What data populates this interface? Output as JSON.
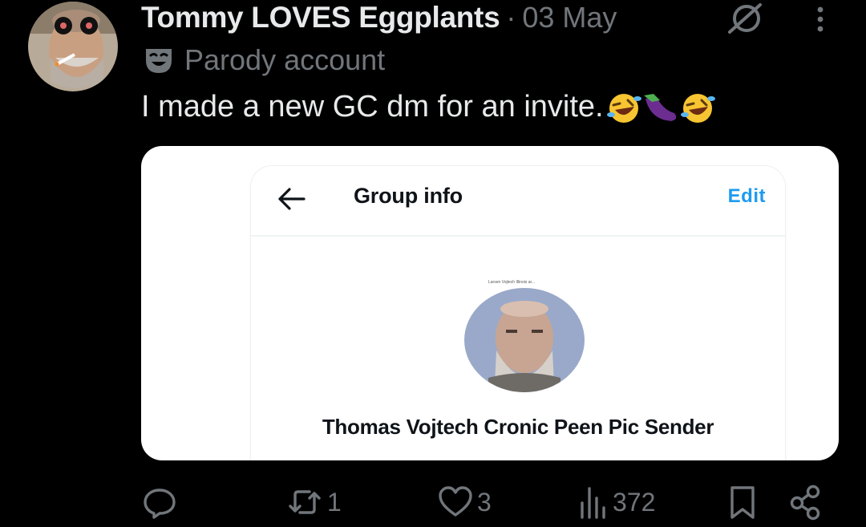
{
  "tweet": {
    "display_name": "Tommy LOVES Eggplants",
    "separator": "·",
    "date": "03 May",
    "parody_label": "Parody account",
    "text": "I made a new GC dm for an invite.",
    "emojis": [
      "rolling-on-floor-laughing",
      "eggplant",
      "rolling-on-floor-laughing"
    ]
  },
  "embedded": {
    "title": "Group info",
    "edit_label": "Edit",
    "photo_caption": "Larsen Vojtech Illinois ar...",
    "group_name": "Thomas Vojtech Cronic Peen Pic Sender"
  },
  "actions": {
    "reply_count": "",
    "retweet_count": "1",
    "like_count": "3",
    "view_count": "372"
  },
  "icons": [
    "grok-icon",
    "more-icon",
    "parody-mask-icon",
    "back-arrow-icon",
    "reply-icon",
    "retweet-icon",
    "like-icon",
    "views-icon",
    "bookmark-icon",
    "share-icon"
  ],
  "colors": {
    "background": "#000000",
    "text_primary": "#e7e9ea",
    "text_secondary": "#71767b",
    "accent": "#1d9bf0"
  }
}
